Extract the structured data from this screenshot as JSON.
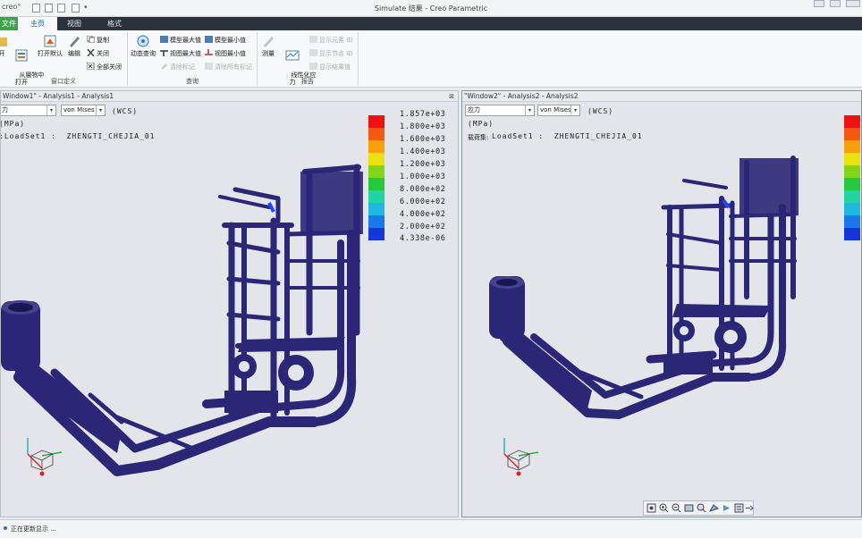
{
  "app": {
    "logo": "creo°",
    "title": "Simulate 结果 - Creo Parametric"
  },
  "tabs": [
    {
      "label": "文件"
    },
    {
      "label": "主页"
    },
    {
      "label": "视图"
    },
    {
      "label": "格式"
    }
  ],
  "ribbon": {
    "window_group": {
      "label": "窗口定义",
      "open_from_layout": "从層物中\n打开",
      "open_default": "打开默认",
      "edit": "编辑",
      "copy": "复制",
      "close": "关闭",
      "close_all": "全部关闭",
      "open_partial": "开"
    },
    "query_group": {
      "label": "查询",
      "dynamic_query": "动态查询",
      "model_max": "模型最大值",
      "model_min": "模型最小值",
      "view_max": "视图最大值",
      "view_min": "视图最小值",
      "clear_markers": "清除标记",
      "clear_all_markers": "清除所有标记"
    },
    "report_group": {
      "label": "报告",
      "measure": "测量",
      "linearized_stress": "线性化应\n力",
      "show_element_id": "显示元素 ID",
      "show_node_id": "显示节点 ID",
      "show_result_tree": "显示结果值"
    }
  },
  "windows": [
    {
      "header": "Window1\" - Analysis1 - Analysis1",
      "result_type": "力",
      "component": "von Mises",
      "wcs": "(WCS)",
      "units": "(MPa)",
      "loadset": ":LoadSet1 :  ZHENGTI_CHEJIA_01",
      "legend": [
        "1.857e+03",
        "1.800e+03",
        "1.600e+03",
        "1.400e+03",
        "1.200e+03",
        "1.000e+03",
        "8.000e+02",
        "6.000e+02",
        "4.000e+02",
        "2.000e+02",
        "4.338e-06"
      ]
    },
    {
      "header": "\"Window2\" - Analysis2 - Analysis2",
      "result_type": "应力",
      "component": "von Mises",
      "wcs": "(WCS)",
      "units": "(MPa)",
      "loadset_prefix": "载荷集:",
      "loadset": "LoadSet1 :  ZHENGTI_CHEJIA_01"
    }
  ],
  "legend_colors": [
    "#f01212",
    "#f25b0c",
    "#f7a10a",
    "#e9e20e",
    "#7fd61a",
    "#23c83c",
    "#22d3a4",
    "#1fb8e0",
    "#1a78ec",
    "#1537d8",
    "#1a1a7a"
  ],
  "model_color": "#2b2675",
  "status": {
    "text": "正在更新显示 ..."
  }
}
